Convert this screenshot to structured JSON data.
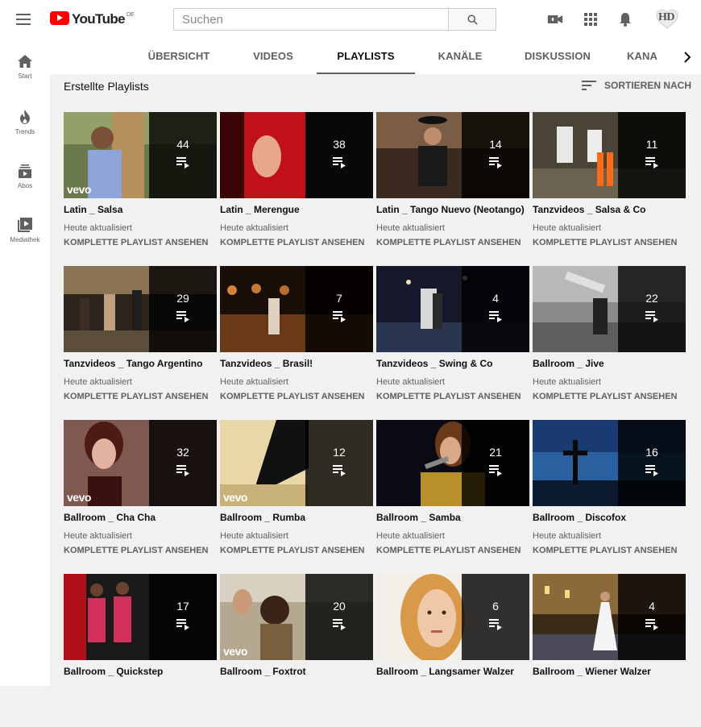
{
  "header": {
    "logo_text": "YouTube",
    "logo_country": "DE",
    "search_placeholder": "Suchen",
    "avatar_text": "HD"
  },
  "nav": {
    "items": [
      {
        "label": "Start",
        "icon": "home-icon"
      },
      {
        "label": "Trends",
        "icon": "trending-icon"
      },
      {
        "label": "Abos",
        "icon": "subscriptions-icon"
      },
      {
        "label": "Mediathek",
        "icon": "library-icon"
      }
    ]
  },
  "tabs": [
    {
      "label": "ÜBERSICHT"
    },
    {
      "label": "VIDEOS"
    },
    {
      "label": "PLAYLISTS",
      "active": true
    },
    {
      "label": "KANÄLE"
    },
    {
      "label": "DISKUSSION"
    },
    {
      "label": "KANA"
    }
  ],
  "section": {
    "title": "Erstellte Playlists",
    "sort_label": "SORTIEREN NACH"
  },
  "common": {
    "updated": "Heute aktualisiert",
    "view_all": "KOMPLETTE PLAYLIST ANSEHEN",
    "vevo": "vevo"
  },
  "colors": {
    "accent": "#ff0000",
    "background": "#f1f1f1"
  },
  "playlists": [
    {
      "title": "Latin _ Salsa",
      "count": "44",
      "vevo": true
    },
    {
      "title": "Latin _ Merengue",
      "count": "38",
      "vevo": false
    },
    {
      "title": "Latin _ Tango Nuevo (Neotango)",
      "count": "14",
      "vevo": false
    },
    {
      "title": "Tanzvideos _ Salsa & Co",
      "count": "11",
      "vevo": false
    },
    {
      "title": "Tanzvideos _ Tango Argentino",
      "count": "29",
      "vevo": false
    },
    {
      "title": "Tanzvideos _ Brasil!",
      "count": "7",
      "vevo": false
    },
    {
      "title": "Tanzvideos _ Swing & Co",
      "count": "4",
      "vevo": false
    },
    {
      "title": "Ballroom _ Jive",
      "count": "22",
      "vevo": false
    },
    {
      "title": "Ballroom _ Cha Cha",
      "count": "32",
      "vevo": true
    },
    {
      "title": "Ballroom _ Rumba",
      "count": "12",
      "vevo": true
    },
    {
      "title": "Ballroom _ Samba",
      "count": "21",
      "vevo": false
    },
    {
      "title": "Ballroom _ Discofox",
      "count": "16",
      "vevo": false
    },
    {
      "title": "Ballroom _ Quickstep",
      "count": "17",
      "vevo": false
    },
    {
      "title": "Ballroom _ Foxtrot",
      "count": "20",
      "vevo": true
    },
    {
      "title": "Ballroom _ Langsamer Walzer",
      "count": "6",
      "vevo": false
    },
    {
      "title": "Ballroom _ Wiener Walzer",
      "count": "4",
      "vevo": false
    }
  ]
}
